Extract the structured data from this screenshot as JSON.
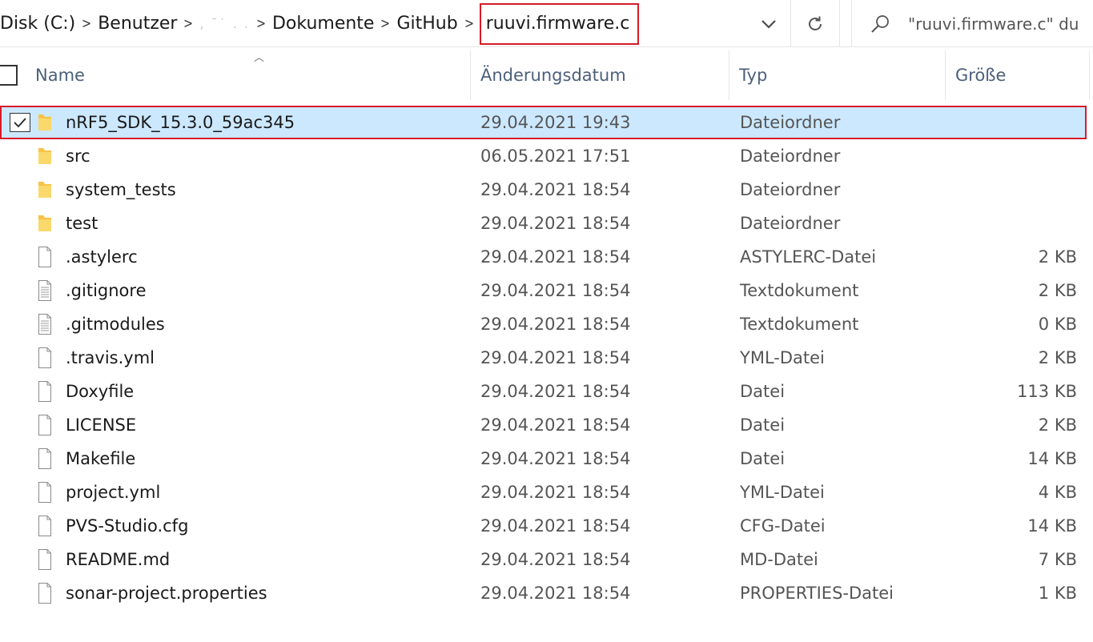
{
  "breadcrumbs": {
    "items": [
      "Disk (C:)",
      "Benutzer",
      ", ˉ˙ . .",
      "Dokumente",
      "GitHub"
    ],
    "current": "ruuvi.firmware.c"
  },
  "search": {
    "placeholder": "\"ruuvi.firmware.c\" du"
  },
  "icons": {
    "dropdown": "chevron-down-icon",
    "refresh": "refresh-icon",
    "search": "search-icon",
    "folder": "folder-icon",
    "file": "file-icon",
    "text_file": "text-file-icon",
    "check": "check-icon"
  },
  "columns": {
    "name": "Name",
    "date": "Änderungsdatum",
    "type": "Typ",
    "size": "Größe"
  },
  "colors": {
    "selection": "#cce8ff",
    "highlight": "#d81b2a",
    "folder": "#f6c344"
  },
  "files": [
    {
      "name": "nRF5_SDK_15.3.0_59ac345",
      "date": "29.04.2021 19:43",
      "type": "Dateiordner",
      "size": "",
      "icon": "folder",
      "selected": true
    },
    {
      "name": "src",
      "date": "06.05.2021 17:51",
      "type": "Dateiordner",
      "size": "",
      "icon": "folder",
      "selected": false
    },
    {
      "name": "system_tests",
      "date": "29.04.2021 18:54",
      "type": "Dateiordner",
      "size": "",
      "icon": "folder",
      "selected": false
    },
    {
      "name": "test",
      "date": "29.04.2021 18:54",
      "type": "Dateiordner",
      "size": "",
      "icon": "folder",
      "selected": false
    },
    {
      "name": ".astylerc",
      "date": "29.04.2021 18:54",
      "type": "ASTYLERC-Datei",
      "size": "2 KB",
      "icon": "file",
      "selected": false
    },
    {
      "name": ".gitignore",
      "date": "29.04.2021 18:54",
      "type": "Textdokument",
      "size": "2 KB",
      "icon": "text",
      "selected": false
    },
    {
      "name": ".gitmodules",
      "date": "29.04.2021 18:54",
      "type": "Textdokument",
      "size": "0 KB",
      "icon": "text",
      "selected": false
    },
    {
      "name": ".travis.yml",
      "date": "29.04.2021 18:54",
      "type": "YML-Datei",
      "size": "2 KB",
      "icon": "file",
      "selected": false
    },
    {
      "name": "Doxyfile",
      "date": "29.04.2021 18:54",
      "type": "Datei",
      "size": "113 KB",
      "icon": "file",
      "selected": false
    },
    {
      "name": "LICENSE",
      "date": "29.04.2021 18:54",
      "type": "Datei",
      "size": "2 KB",
      "icon": "file",
      "selected": false
    },
    {
      "name": "Makefile",
      "date": "29.04.2021 18:54",
      "type": "Datei",
      "size": "14 KB",
      "icon": "file",
      "selected": false
    },
    {
      "name": "project.yml",
      "date": "29.04.2021 18:54",
      "type": "YML-Datei",
      "size": "4 KB",
      "icon": "file",
      "selected": false
    },
    {
      "name": "PVS-Studio.cfg",
      "date": "29.04.2021 18:54",
      "type": "CFG-Datei",
      "size": "14 KB",
      "icon": "file",
      "selected": false
    },
    {
      "name": "README.md",
      "date": "29.04.2021 18:54",
      "type": "MD-Datei",
      "size": "7 KB",
      "icon": "file",
      "selected": false
    },
    {
      "name": "sonar-project.properties",
      "date": "29.04.2021 18:54",
      "type": "PROPERTIES-Datei",
      "size": "1 KB",
      "icon": "file",
      "selected": false
    }
  ]
}
